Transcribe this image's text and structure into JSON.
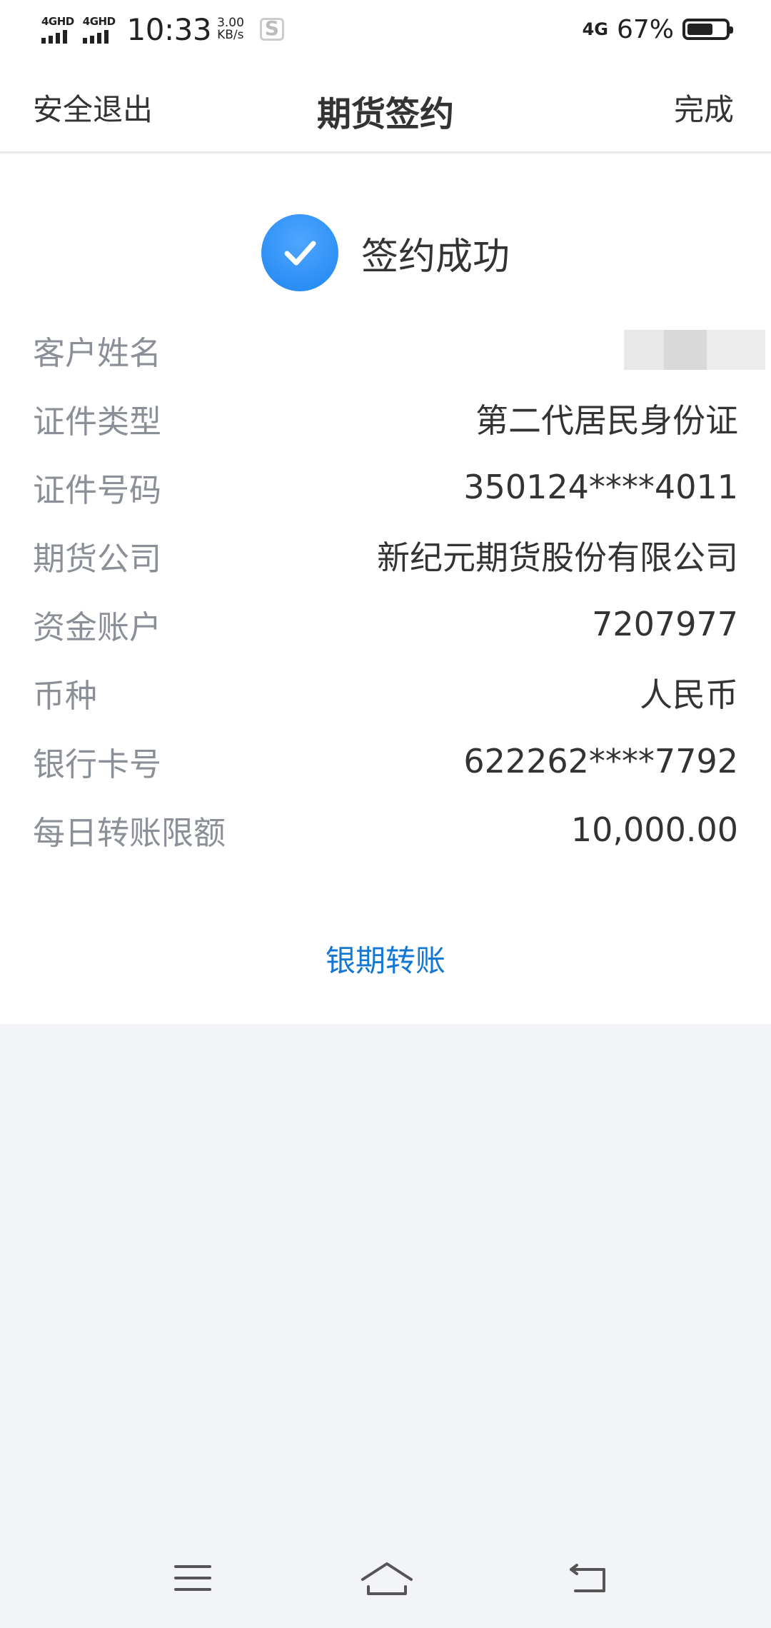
{
  "status_bar": {
    "signal_1": "4GHD",
    "signal_2": "4GHD",
    "time": "10:33",
    "speed_value": "3.00",
    "speed_unit": "KB/s",
    "network": "4G",
    "battery": "67%"
  },
  "nav": {
    "left_label": "安全退出",
    "title": "期货签约",
    "right_label": "完成"
  },
  "success": {
    "text": "签约成功"
  },
  "details": [
    {
      "label": "客户姓名",
      "value": ""
    },
    {
      "label": "证件类型",
      "value": "第二代居民身份证"
    },
    {
      "label": "证件号码",
      "value": "350124****4011"
    },
    {
      "label": "期货公司",
      "value": "新纪元期货股份有限公司"
    },
    {
      "label": "资金账户",
      "value": "7207977"
    },
    {
      "label": "币种",
      "value": "人民币"
    },
    {
      "label": "银行卡号",
      "value": "622262****7792"
    },
    {
      "label": "每日转账限额",
      "value": "10,000.00"
    }
  ],
  "action_link": "银期转账",
  "colors": {
    "accent": "#1677d2",
    "check": "#2a8ff5",
    "label": "#8b8f98",
    "background": "#f3f4f8"
  },
  "icons": {
    "menu": "menu-icon",
    "home": "home-icon",
    "back": "back-icon",
    "check": "check-icon"
  }
}
